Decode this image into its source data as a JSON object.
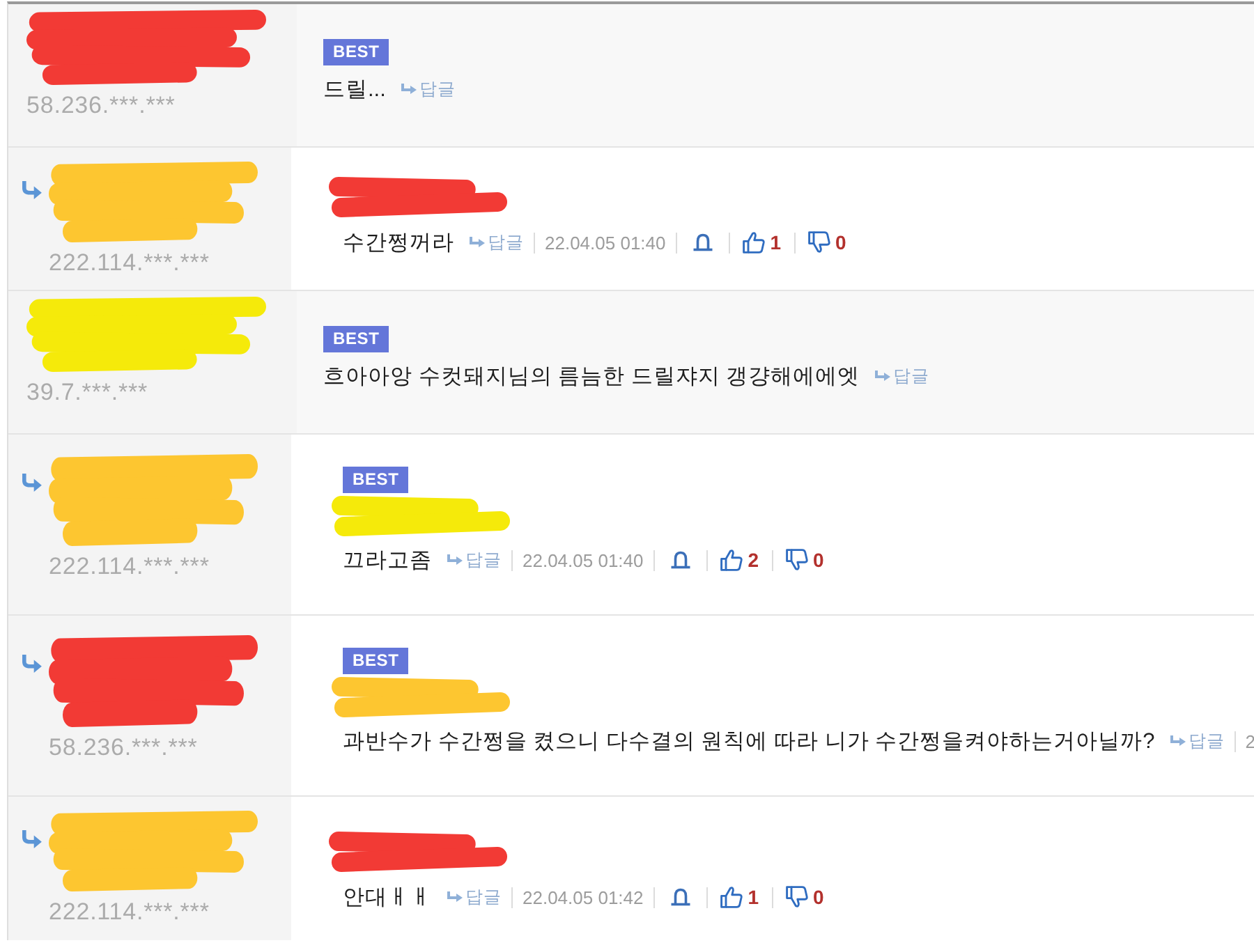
{
  "comments": [
    {
      "reply": false,
      "nickname_redaction": {
        "color": "#f23a35"
      },
      "ip": "58.236.***.***",
      "badge": "BEST",
      "text": "드릴...",
      "reply_label": "답글"
    },
    {
      "reply": true,
      "nickname_redaction": {
        "color": "#fdc630"
      },
      "ip": "222.114.***.***",
      "mention_redaction": {
        "color": "#f23a35"
      },
      "text": "수간쩡꺼라",
      "reply_label": "답글",
      "date": "22.04.05 01:40",
      "likes": "1",
      "dislikes": "0"
    },
    {
      "reply": false,
      "nickname_redaction": {
        "color": "#f5ea0a"
      },
      "ip": "39.7.***.***",
      "badge": "BEST",
      "text": "흐아아앙 수컷돼지님의 름늠한 드릴쟈지 갱걍해에에엣",
      "reply_label": "답글"
    },
    {
      "reply": true,
      "nickname_redaction": {
        "color": "#fdc630"
      },
      "ip": "222.114.***.***",
      "badge": "BEST",
      "mention_redaction": {
        "color": "#f5ea0a"
      },
      "text": "끄라고좀",
      "reply_label": "답글",
      "date": "22.04.05 01:40",
      "likes": "2",
      "dislikes": "0"
    },
    {
      "reply": true,
      "nickname_redaction": {
        "color": "#f23a35"
      },
      "ip": "58.236.***.***",
      "badge": "BEST",
      "mention_redaction": {
        "color": "#fdc630"
      },
      "text": "과반수가 수간쩡을 켰으니 다수결의 원칙에 따라 니가 수간쩡을켜야하는거아닐까?",
      "reply_label": "답글",
      "date": "2"
    },
    {
      "reply": true,
      "nickname_redaction": {
        "color": "#fdc630"
      },
      "ip": "222.114.***.***",
      "mention_redaction": {
        "color": "#f23a35"
      },
      "text": "안대ㅐㅐ",
      "reply_label": "답글",
      "date": "22.04.05 01:42",
      "likes": "1",
      "dislikes": "0"
    }
  ]
}
